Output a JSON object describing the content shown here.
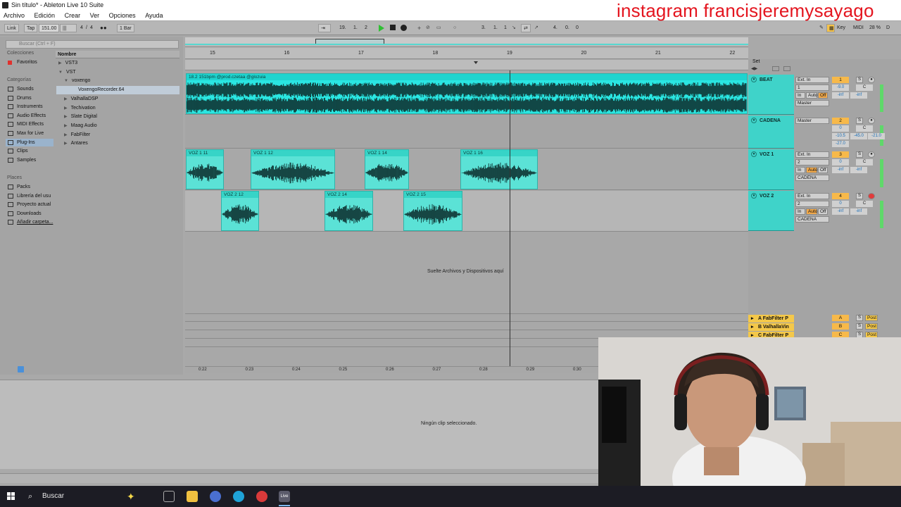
{
  "window": {
    "title": "Sin título* - Ableton Live 10 Suite"
  },
  "watermark": "instagram francisjeremysayago",
  "menu": [
    "Archivo",
    "Edición",
    "Crear",
    "Ver",
    "Opciones",
    "Ayuda"
  ],
  "control_bar": {
    "link": "Link",
    "tap": "Tap",
    "tempo": "151.00",
    "meter_num": "4",
    "meter_den": "4",
    "quantize": "1 Bar",
    "position": [
      "19.",
      "1.",
      "2"
    ],
    "loop_start": [
      "3.",
      "1.",
      "1"
    ],
    "loop_length": [
      "4.",
      "0.",
      "0"
    ],
    "key": "Key",
    "midi": "MIDI",
    "cpu": "28 %",
    "hw": "D"
  },
  "browser": {
    "search_placeholder": "Buscar (Ctrl + F)",
    "col_header": "Nombre",
    "collections_label": "Colecciones",
    "favorites": "Favoritos",
    "categories_label": "Categorías",
    "categories": [
      "Sounds",
      "Drums",
      "Instruments",
      "Audio Effects",
      "MIDI Effects",
      "Max for Live",
      "Plug-Ins",
      "Clips",
      "Samples"
    ],
    "selected_category": "Plug-Ins",
    "places_label": "Places",
    "places": [
      "Packs",
      "Librería del usu",
      "Proyecto actual",
      "Downloads",
      "Añadir carpeta..."
    ],
    "tree": [
      {
        "label": "VST3",
        "indent": 0,
        "tri": "▶"
      },
      {
        "label": "VST",
        "indent": 0,
        "tri": "▼"
      },
      {
        "label": "voxengo",
        "indent": 1,
        "tri": "▼"
      },
      {
        "label": "VoxengoRecorder.64",
        "indent": 2,
        "tri": ""
      },
      {
        "label": "ValhallaDSP",
        "indent": 1,
        "tri": "▶"
      },
      {
        "label": "Techivation",
        "indent": 1,
        "tri": "▶"
      },
      {
        "label": "Slate Digital",
        "indent": 1,
        "tri": "▶"
      },
      {
        "label": "Maag Audio",
        "indent": 1,
        "tri": "▶"
      },
      {
        "label": "FabFilter",
        "indent": 1,
        "tri": "▶"
      },
      {
        "label": "Antares",
        "indent": 1,
        "tri": "▶"
      }
    ]
  },
  "ruler": [
    "15",
    "16",
    "17",
    "18",
    "19",
    "20",
    "21",
    "22"
  ],
  "time_ticks": [
    "0:22",
    "0:23",
    "0:24",
    "0:25",
    "0:26",
    "0:27",
    "0:28",
    "0:29",
    "0:30"
  ],
  "clips": {
    "beat": "18.2 151bpm @prod.czetaa @glozuia",
    "voz1": [
      "VOZ 1 11",
      "VOZ 1 12",
      "VOZ 1 14",
      "VOZ 1 16"
    ],
    "voz2": [
      "VOZ 2 12",
      "VOZ 2 14",
      "VOZ 2 15"
    ]
  },
  "drop_text": "Suelte Archivos y Dispositivos aquí",
  "mixer": {
    "set_label": "Set",
    "tracks": [
      {
        "name": "BEAT",
        "input": "Ext. In",
        "chan": "1",
        "out": "Master",
        "num": "1",
        "vol": "-9.0",
        "pan": "C",
        "send1": "-inf",
        "send2": "-inf"
      },
      {
        "name": "CADENA",
        "input": "Master",
        "chan": "",
        "out": "",
        "num": "2",
        "vol": "0",
        "pan": "C",
        "send1": "-10.5",
        "send2": "-45.0"
      },
      {
        "name": "VOZ 1",
        "input": "Ext. In",
        "chan": "2",
        "out": "CADENA",
        "num": "3",
        "vol": "0",
        "pan": "C",
        "send1": "-inf",
        "send2": "-inf"
      },
      {
        "name": "VOZ 2",
        "input": "Ext. In",
        "chan": "2",
        "out": "CADENA",
        "num": "4",
        "vol": "0",
        "pan": "C",
        "send1": "-inf",
        "send2": "-inf"
      }
    ],
    "monitor": {
      "in": "In",
      "auto": "Auto",
      "off": "Off"
    },
    "cadena_extra": [
      "-21.0",
      "-27.0"
    ],
    "returns": [
      {
        "name": "A FabFilter P",
        "letter": "A",
        "post": "Post"
      },
      {
        "name": "B ValhallaVin",
        "letter": "B",
        "post": "Post"
      },
      {
        "name": "C FabFilter P",
        "letter": "C",
        "post": "Post"
      }
    ]
  },
  "detail": {
    "no_clip": "Ningún clip seleccionado."
  },
  "taskbar": {
    "search": "Buscar"
  }
}
